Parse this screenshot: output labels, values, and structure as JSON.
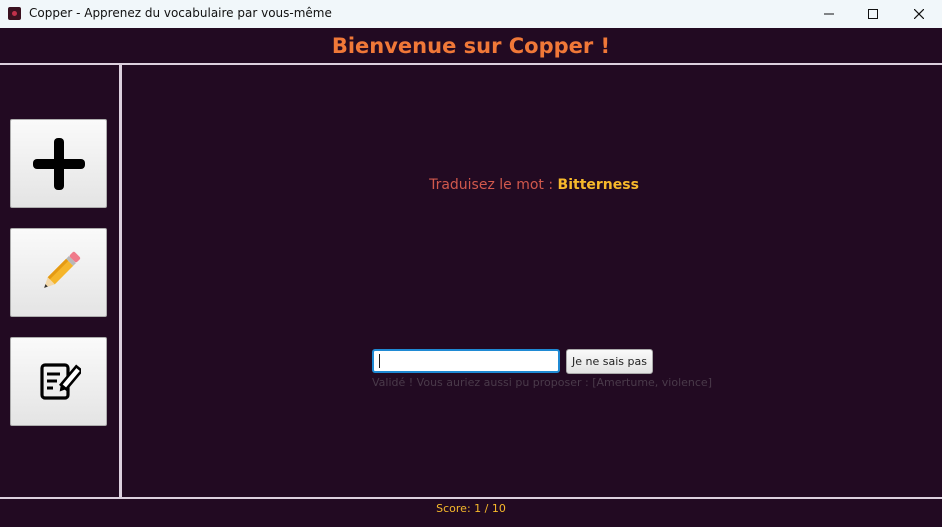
{
  "window": {
    "title": "Copper - Apprenez du vocabulaire par vous-même",
    "icon": "copper-app-icon",
    "controls": [
      "minimize-icon",
      "maximize-icon",
      "close-icon"
    ]
  },
  "header": {
    "title": "Bienvenue sur Copper !"
  },
  "sidebar": {
    "buttons": [
      {
        "name": "add",
        "icon": "plus-icon"
      },
      {
        "name": "edit",
        "icon": "pencil-icon"
      },
      {
        "name": "notes",
        "icon": "edit-document-icon"
      }
    ]
  },
  "quiz": {
    "prompt_label": "Traduisez le mot :",
    "word": "Bitterness",
    "input_value": "",
    "dont_know_label": "Je ne sais pas",
    "feedback": "Validé ! Vous auriez aussi pu proposer : [Amertume, violence]"
  },
  "footer": {
    "score": "Score: 1 / 10"
  },
  "colors": {
    "background": "#220a22",
    "header_title": "#f07838",
    "prompt_label": "#d1584c",
    "word": "#f7b92b",
    "score": "#f7b92b",
    "divider": "#dcd0de",
    "input_focus": "#1f8ad4"
  }
}
